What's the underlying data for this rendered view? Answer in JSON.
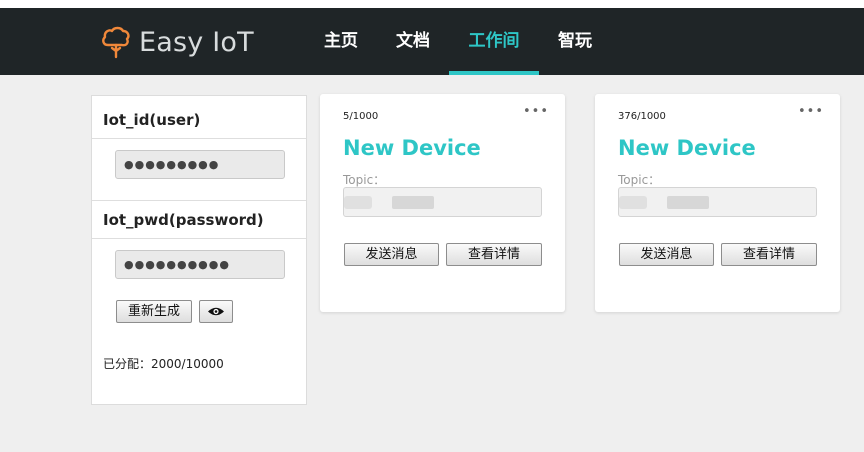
{
  "header": {
    "brand": "Easy IoT",
    "nav": [
      {
        "label": "主页",
        "active": false
      },
      {
        "label": "文档",
        "active": false
      },
      {
        "label": "工作间",
        "active": true
      },
      {
        "label": "智玩",
        "active": false
      }
    ]
  },
  "sidebar": {
    "iot_id_label": "Iot_id(user)",
    "iot_id_value": "●●●●●●●●●",
    "iot_pwd_label": "Iot_pwd(password)",
    "iot_pwd_value": "●●●●●●●●●●",
    "regenerate_label": "重新生成",
    "show_icon": "eye-icon",
    "allocated_label": "已分配：",
    "allocated_value": "2000/10000"
  },
  "devices": [
    {
      "count": "5/1000",
      "name": "New Device",
      "topic_label": "Topic：",
      "send_label": "发送消息",
      "detail_label": "查看详情",
      "menu": "•••"
    },
    {
      "count": "376/1000",
      "name": "New Device",
      "topic_label": "Topic：",
      "send_label": "发送消息",
      "detail_label": "查看详情",
      "menu": "•••"
    }
  ],
  "colors": {
    "accent": "#2ec6c6",
    "topbar": "#1f2527",
    "logo": "#f0883a"
  }
}
